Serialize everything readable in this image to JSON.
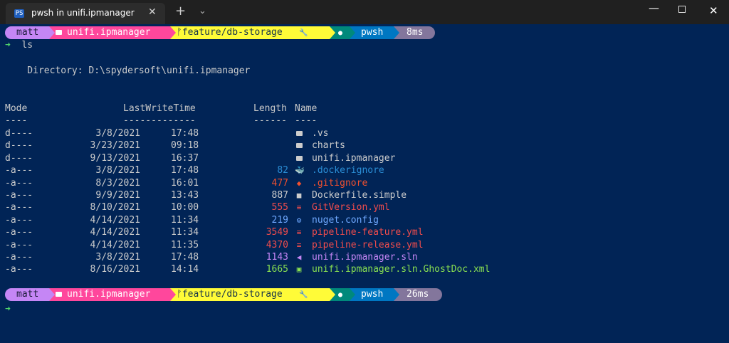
{
  "window": {
    "tab_title": "pwsh in unifi.ipmanager",
    "tab_icon": "PS",
    "close_glyph": "✕",
    "newtab_glyph": "+",
    "dropdown_glyph": "⌄",
    "min_glyph": "—",
    "close_win_glyph": "✕"
  },
  "prompt1": {
    "user": "matt",
    "dir": "unifi.ipmanager",
    "branch_icon": "ᚠ",
    "branch": "feature/db-storage",
    "status_icon": "🔧",
    "dotnet_icon": "●",
    "shell": "pwsh",
    "duration": "8ms"
  },
  "command": {
    "arrow": "➜",
    "text": "ls"
  },
  "listing": {
    "directory_label": "    Directory: D:\\spydersoft\\unifi.ipmanager",
    "headers": {
      "mode": "Mode",
      "lastwrite": "LastWriteTime",
      "length": "Length",
      "name": "Name"
    },
    "underline": {
      "mode": "----",
      "lastwrite": "-------------",
      "length": "------",
      "name": "----"
    },
    "rows": [
      {
        "mode": "d----",
        "date": "3/8/2021",
        "time": "17:48",
        "length": "",
        "icon": "folder-icon",
        "name": ".vs",
        "color": "#cccccc"
      },
      {
        "mode": "d----",
        "date": "3/23/2021",
        "time": "09:18",
        "length": "",
        "icon": "folder-icon",
        "name": "charts",
        "color": "#cccccc"
      },
      {
        "mode": "d----",
        "date": "9/13/2021",
        "time": "16:37",
        "length": "",
        "icon": "folder-icon",
        "name": "unifi.ipmanager",
        "color": "#cccccc"
      },
      {
        "mode": "-a---",
        "date": "3/8/2021",
        "time": "17:48",
        "length": "82",
        "icon": "docker-icon",
        "glyph": "🐳",
        "name": ".dockerignore",
        "color": "#2b8ed6"
      },
      {
        "mode": "-a---",
        "date": "8/3/2021",
        "time": "16:01",
        "length": "477",
        "icon": "git-icon",
        "glyph": "◆",
        "name": ".gitignore",
        "color": "#f1502f"
      },
      {
        "mode": "-a---",
        "date": "9/9/2021",
        "time": "13:43",
        "length": "887",
        "icon": "file-icon",
        "glyph": "■",
        "name": "Dockerfile.simple",
        "color": "#cccccc"
      },
      {
        "mode": "-a---",
        "date": "8/10/2021",
        "time": "10:00",
        "length": "555",
        "icon": "yaml-icon",
        "glyph": "≡",
        "name": "GitVersion.yml",
        "color": "#f14c4c"
      },
      {
        "mode": "-a---",
        "date": "4/14/2021",
        "time": "11:34",
        "length": "219",
        "icon": "gear-icon",
        "glyph": "⚙",
        "name": "nuget.config",
        "color": "#6fa8ff"
      },
      {
        "mode": "-a---",
        "date": "4/14/2021",
        "time": "11:34",
        "length": "3549",
        "icon": "yaml-icon",
        "glyph": "≡",
        "name": "pipeline-feature.yml",
        "color": "#f14c4c"
      },
      {
        "mode": "-a---",
        "date": "4/14/2021",
        "time": "11:35",
        "length": "4370",
        "icon": "yaml-icon",
        "glyph": "≡",
        "name": "pipeline-release.yml",
        "color": "#f14c4c"
      },
      {
        "mode": "-a---",
        "date": "3/8/2021",
        "time": "17:48",
        "length": "1143",
        "icon": "visualstudio-icon",
        "glyph": "◀",
        "name": "unifi.ipmanager.sln",
        "color": "#c586f5"
      },
      {
        "mode": "-a---",
        "date": "8/16/2021",
        "time": "14:14",
        "length": "1665",
        "icon": "xml-icon",
        "glyph": "▣",
        "name": "unifi.ipmanager.sln.GhostDoc.xml",
        "color": "#89e051"
      }
    ]
  },
  "prompt2": {
    "user": "matt",
    "dir": "unifi.ipmanager",
    "branch_icon": "ᚠ",
    "branch": "feature/db-storage",
    "status_icon": "🔧",
    "dotnet_icon": "●",
    "shell": "pwsh",
    "duration": "26ms"
  },
  "cursor_arrow": "➜",
  "colors": {
    "background": "#012456",
    "user_segment": "#c586f5",
    "dir_segment": "#ff479c",
    "git_segment": "#fffb38",
    "dotnet_segment": "#00897b",
    "shell_segment": "#0077c2",
    "time_segment": "#83769c"
  }
}
